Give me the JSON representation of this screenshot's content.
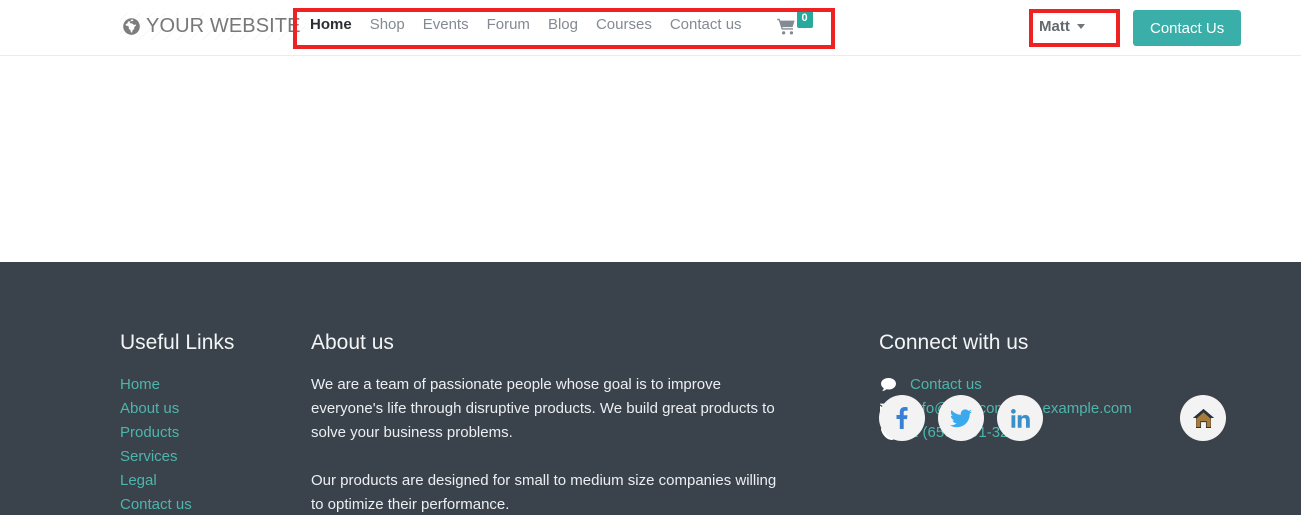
{
  "header": {
    "brand": {
      "icon": "globe-icon",
      "text": "YOUR WEBSITE"
    },
    "nav_items": [
      {
        "label": "Home",
        "active": true
      },
      {
        "label": "Shop",
        "active": false
      },
      {
        "label": "Events",
        "active": false
      },
      {
        "label": "Forum",
        "active": false
      },
      {
        "label": "Blog",
        "active": false
      },
      {
        "label": "Courses",
        "active": false
      },
      {
        "label": "Contact us",
        "active": false
      }
    ],
    "cart": {
      "icon": "shopping-cart-icon",
      "count": "0"
    },
    "user_menu": {
      "name": "Matt",
      "caret_icon": "chevron-down-icon"
    },
    "contact_button": "Contact Us"
  },
  "footer": {
    "useful_links": {
      "heading": "Useful Links",
      "items": [
        {
          "label": "Home"
        },
        {
          "label": "About us"
        },
        {
          "label": "Products"
        },
        {
          "label": "Services"
        },
        {
          "label": "Legal"
        },
        {
          "label": "Contact us"
        }
      ]
    },
    "about": {
      "heading": "About us",
      "paragraphs": [
        "We are a team of passionate people whose goal is to improve everyone's life through disruptive products. We build great products to solve your business problems.",
        "Our products are designed for small to medium size companies willing to optimize their performance."
      ]
    },
    "connect": {
      "heading": "Connect with us",
      "items": [
        {
          "icon": "comment-icon",
          "label": "Contact us"
        },
        {
          "icon": "envelope-icon",
          "label": "info@yourcompany.example.com"
        },
        {
          "icon": "phone-icon",
          "label": "1 (650) 691-3277"
        }
      ],
      "socials": [
        {
          "icon": "facebook-icon"
        },
        {
          "icon": "twitter-icon"
        },
        {
          "icon": "linkedin-icon"
        }
      ],
      "home_button": {
        "icon": "home-icon"
      }
    }
  },
  "colors": {
    "accent_teal": "#3aafa9",
    "link_teal": "#4db6ac",
    "badge_teal": "#28a99e",
    "footer_bg": "#3a424b",
    "annotation_red": "#ee2222",
    "nav_muted": "#838a92"
  }
}
